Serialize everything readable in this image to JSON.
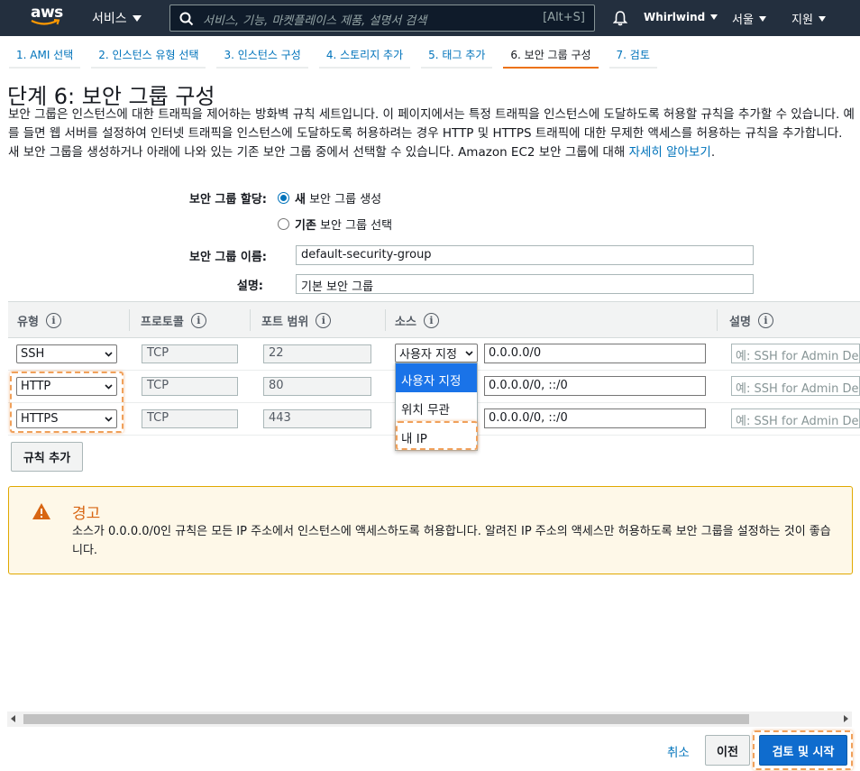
{
  "nav": {
    "logo": "aws",
    "services": "서비스",
    "search_placeholder": "서비스, 기능, 마켓플레이스 제품, 설명서 검색",
    "search_shortcut": "[Alt+S]",
    "user": "Whirlwind",
    "region": "서울",
    "support": "지원"
  },
  "steps": [
    {
      "label": "1. AMI 선택"
    },
    {
      "label": "2. 인스턴스 유형 선택"
    },
    {
      "label": "3. 인스턴스 구성"
    },
    {
      "label": "4. 스토리지 추가"
    },
    {
      "label": "5. 태그 추가"
    },
    {
      "label": "6. 보안 그룹 구성",
      "active": true
    },
    {
      "label": "7. 검토"
    }
  ],
  "page": {
    "title": "단계 6: 보안 그룹 구성",
    "intro": "보안 그룹은 인스턴스에 대한 트래픽을 제어하는 방화벽 규칙 세트입니다. 이 페이지에서는 특정 트래픽을 인스턴스에 도달하도록 허용할 규칙을 추가할 수 있습니다. 예를 들면 웹 서버를 설정하여 인터넷 트래픽을 인스턴스에 도달하도록 허용하려는 경우 HTTP 및 HTTPS 트래픽에 대한 무제한 액세스를 허용하는 규칙을 추가합니다. 새 보안 그룹을 생성하거나 아래에 나와 있는 기존 보안 그룹 중에서 선택할 수 있습니다. Amazon EC2 보안 그룹에 대해 ",
    "learn_more": "자세히 알아보기",
    "learn_more_suffix": "."
  },
  "form": {
    "assign_label": "보안 그룹 할당:",
    "option_new_bold": "새",
    "option_new_rest": " 보안 그룹 생성",
    "option_existing_bold": "기존",
    "option_existing_rest": " 보안 그룹 선택",
    "name_label": "보안 그룹 이름:",
    "name_value": "default-security-group",
    "desc_label": "설명:",
    "desc_value": "기본 보안 그룹"
  },
  "table": {
    "headers": {
      "type": "유형",
      "protocol": "프로토콜",
      "port": "포트 범위",
      "source": "소스",
      "description": "설명"
    },
    "rows": [
      {
        "type": "SSH",
        "protocol": "TCP",
        "port": "22",
        "source": "사용자 지정",
        "cidr": "0.0.0.0/0",
        "desc_placeholder": "예: SSH for Admin Desktop"
      },
      {
        "type": "HTTP",
        "protocol": "TCP",
        "port": "80",
        "source": "",
        "cidr": "0.0.0.0/0, ::/0",
        "desc_placeholder": "예: SSH for Admin Desktop"
      },
      {
        "type": "HTTPS",
        "protocol": "TCP",
        "port": "443",
        "source": "",
        "cidr": "0.0.0.0/0, ::/0",
        "desc_placeholder": "예: SSH for Admin Desktop"
      }
    ],
    "dropdown_options": [
      "사용자 지정",
      "위치 무관",
      "내 IP"
    ],
    "add_rule": "규칙 추가"
  },
  "warning": {
    "title": "경고",
    "body": "소스가 0.0.0.0/0인 규칙은 모든 IP 주소에서 인스턴스에 액세스하도록 허용합니다. 알려진 IP 주소의 액세스만 허용하도록 보안 그룹을 설정하는 것이 좋습니다."
  },
  "footer": {
    "cancel": "취소",
    "previous": "이전",
    "review_launch": "검토 및 시작"
  },
  "colors": {
    "nav_bg": "#232f3e",
    "link": "#0073bb",
    "accent": "#ec7211",
    "primary_button": "#0f6cce",
    "warning_bg": "#fef8e8",
    "warning_border": "#e0a800"
  }
}
